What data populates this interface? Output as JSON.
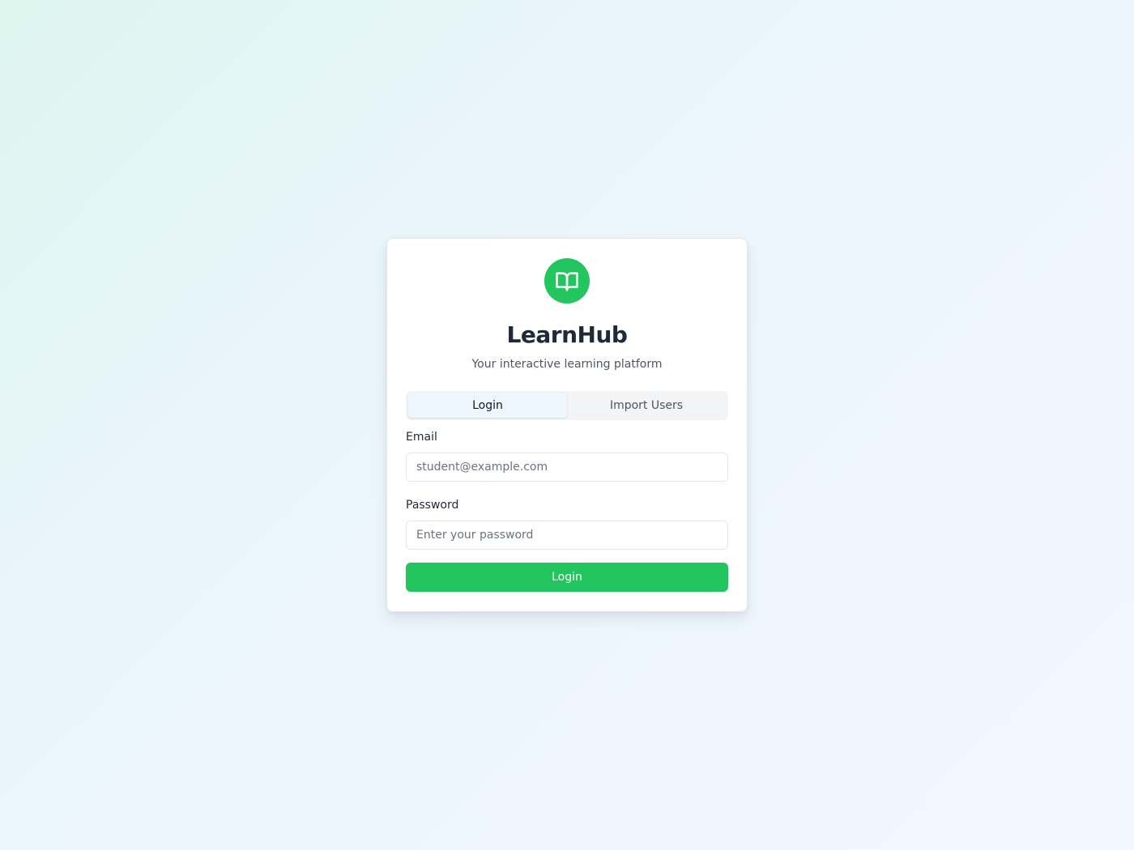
{
  "brand": {
    "name": "LearnHub",
    "tagline": "Your interactive learning platform",
    "logo_icon": "open-book-icon",
    "accent_color": "#22c55e"
  },
  "tabs": [
    {
      "label": "Login",
      "active": true
    },
    {
      "label": "Import Users",
      "active": false
    }
  ],
  "form": {
    "email": {
      "label": "Email",
      "value": "",
      "placeholder": "student@example.com"
    },
    "password": {
      "label": "Password",
      "value": "",
      "placeholder": "Enter your password"
    },
    "submit_label": "Login"
  }
}
